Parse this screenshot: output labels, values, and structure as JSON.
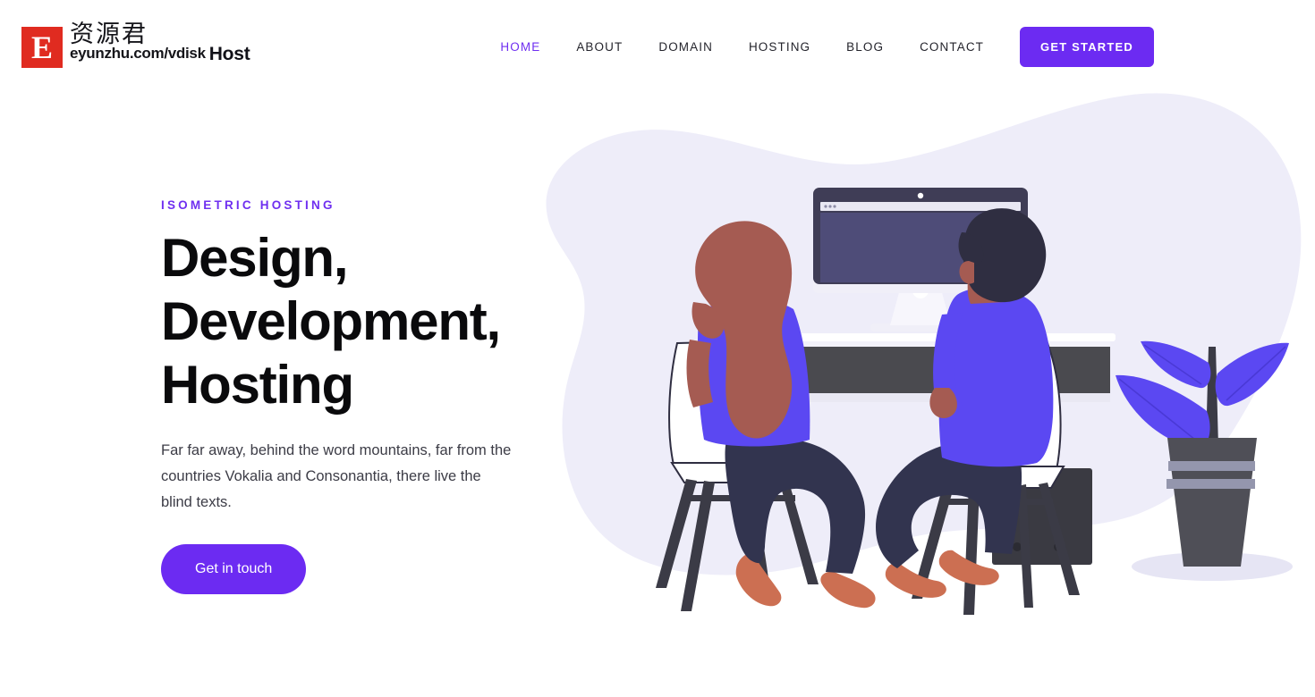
{
  "watermark": {
    "logo_letter": "E",
    "cn_text": "资源君",
    "url": "eyunzhu.com/vdisk"
  },
  "header": {
    "brand": "Host",
    "nav": [
      {
        "label": "HOME",
        "active": true
      },
      {
        "label": "ABOUT",
        "active": false
      },
      {
        "label": "DOMAIN",
        "active": false
      },
      {
        "label": "HOSTING",
        "active": false
      },
      {
        "label": "BLOG",
        "active": false
      },
      {
        "label": "CONTACT",
        "active": false
      }
    ],
    "cta_label": "GET STARTED"
  },
  "hero": {
    "eyebrow": "ISOMETRIC HOSTING",
    "title_line1": "Design,",
    "title_line2": "Development,",
    "title_line3": "Hosting",
    "paragraph": "Far far away, behind the word mountains, far from the countries Vokalia and Consonantia, there live the blind texts.",
    "cta_label": "Get in touch"
  },
  "illustration": {
    "name": "two-people-at-desk-with-monitor-and-plant",
    "blob_color": "#eeedf9",
    "accent_purple": "#5b48f2",
    "skin_tone": "#a55b52",
    "hair_dark": "#2f2e41",
    "jeans": "#32344f",
    "shoe": "#cc6f52",
    "monitor_bezel": "#3f3d56",
    "monitor_screen": "#4e4c78",
    "desk_front": "#4a4a4f",
    "chair_white": "#ffffff",
    "pot_dark": "#4f4f57",
    "pot_stripe": "#9496ad"
  },
  "colors": {
    "accent": "#6c2bf2",
    "nav_text": "#24242c",
    "heading": "#0a0a0c",
    "body_text": "#3c3c46",
    "watermark_red": "#e02b20"
  }
}
